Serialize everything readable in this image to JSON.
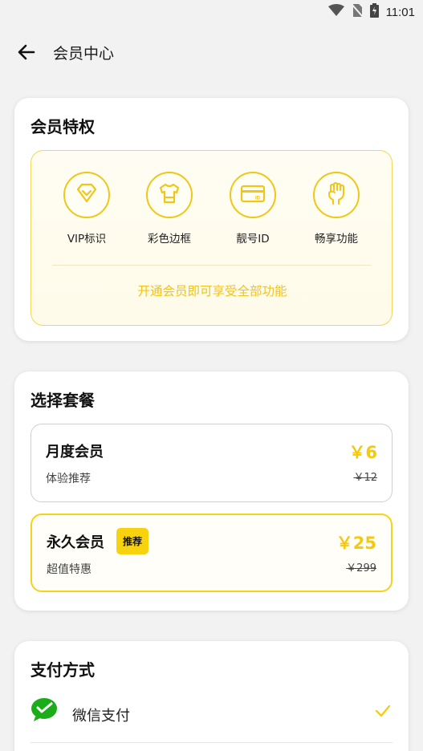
{
  "status_bar": {
    "time": "11:01",
    "icons": [
      "wifi-icon",
      "no-sim-icon",
      "battery-charging-icon"
    ]
  },
  "header": {
    "title": "会员中心",
    "back_icon": "arrow-left-icon"
  },
  "privileges": {
    "title": "会员特权",
    "items": [
      {
        "label": "VIP标识",
        "icon": "diamond-icon"
      },
      {
        "label": "彩色边框",
        "icon": "tshirt-icon"
      },
      {
        "label": "靓号ID",
        "icon": "id-card-icon"
      },
      {
        "label": "畅享功能",
        "icon": "fist-icon"
      }
    ],
    "note": "开通会员即可享受全部功能"
  },
  "plans": {
    "title": "选择套餐",
    "items": [
      {
        "name": "月度会员",
        "desc": "体验推荐",
        "price": "￥6",
        "original": "￥12",
        "selected": false
      },
      {
        "name": "永久会员",
        "desc": "超值特惠",
        "price": "￥25",
        "original": "￥299",
        "badge": "推荐",
        "selected": true
      }
    ]
  },
  "payment": {
    "title": "支付方式",
    "methods": [
      {
        "label": "微信支付",
        "icon": "wechat-pay-icon",
        "selected": true
      }
    ]
  },
  "colors": {
    "accent": "#f6c90f",
    "wechat_green": "#1aad19",
    "background": "#f2f2f2"
  }
}
